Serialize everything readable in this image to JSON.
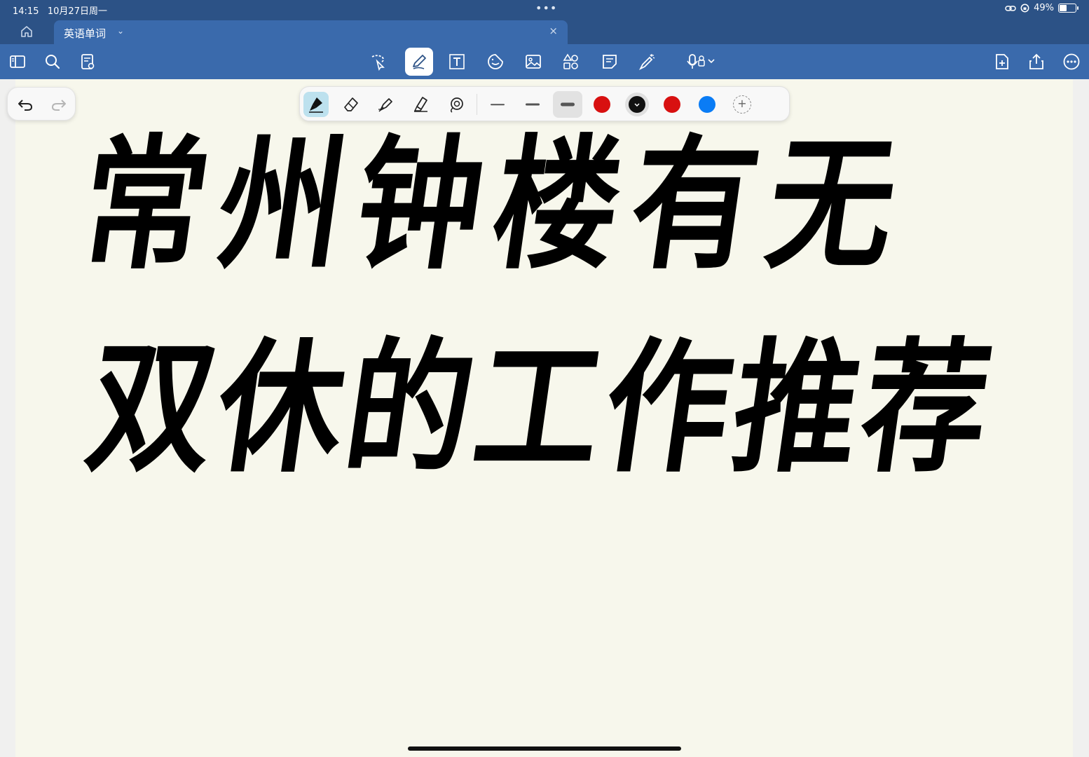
{
  "status": {
    "time": "14:15",
    "date": "10月27日周一",
    "battery_text": "49%",
    "battery_level": 0.49
  },
  "tab": {
    "title": "英语单词",
    "close_glyph": "×",
    "chevron_glyph": "⌄"
  },
  "toolbar": {
    "left_icons": [
      "sidebar-icon",
      "search-icon",
      "document-settings-icon"
    ],
    "center_icons": [
      "lasso-icon",
      "pen-icon",
      "text-box-icon",
      "sticker-icon",
      "image-icon",
      "shapes-icon",
      "sticky-note-icon",
      "laser-pointer-icon",
      "microphone-icon"
    ],
    "right_icons": [
      "add-page-icon",
      "share-icon",
      "more-icon"
    ]
  },
  "pen_palette": {
    "tools": [
      "brush-pen-icon",
      "eraser-icon",
      "fountain-pen-icon",
      "highlighter-icon",
      "lasso-circle-icon"
    ],
    "active_tool": "brush-pen-icon",
    "stroke_widths": [
      "thin",
      "medium",
      "thick"
    ],
    "active_width": "thick",
    "colors": [
      "#d81010",
      "#111111",
      "#d81010",
      "#0a7cf5"
    ],
    "active_color": "#111111",
    "add_color_glyph": "+"
  },
  "canvas": {
    "line1": "常州钟楼有无",
    "line2": "双休的工作推荐"
  },
  "colors": {
    "status_bar": "#2c5286",
    "toolbar": "#3a6aac",
    "paper": "#f7f7ec"
  }
}
